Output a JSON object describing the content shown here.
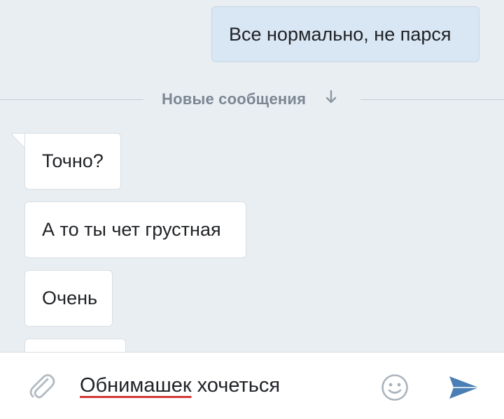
{
  "chat": {
    "outgoing": [
      {
        "text": "Все нормально,  не парся"
      }
    ],
    "divider": {
      "label": "Новые сообщения",
      "icon": "arrow-down-icon"
    },
    "incoming": [
      {
        "text": "Точно?"
      },
      {
        "text": "А то ты чет грустная"
      },
      {
        "text": "Очень"
      },
      {
        "text": ""
      }
    ]
  },
  "composer": {
    "input_value_part1": "Обнимашек",
    "input_value_part2": " хочеться",
    "attach_icon": "paperclip-icon",
    "emoji_icon": "smiley-icon",
    "send_icon": "send-arrow-icon",
    "colors": {
      "send": "#4a7fb5",
      "spellcheck": "#d3383a"
    }
  }
}
